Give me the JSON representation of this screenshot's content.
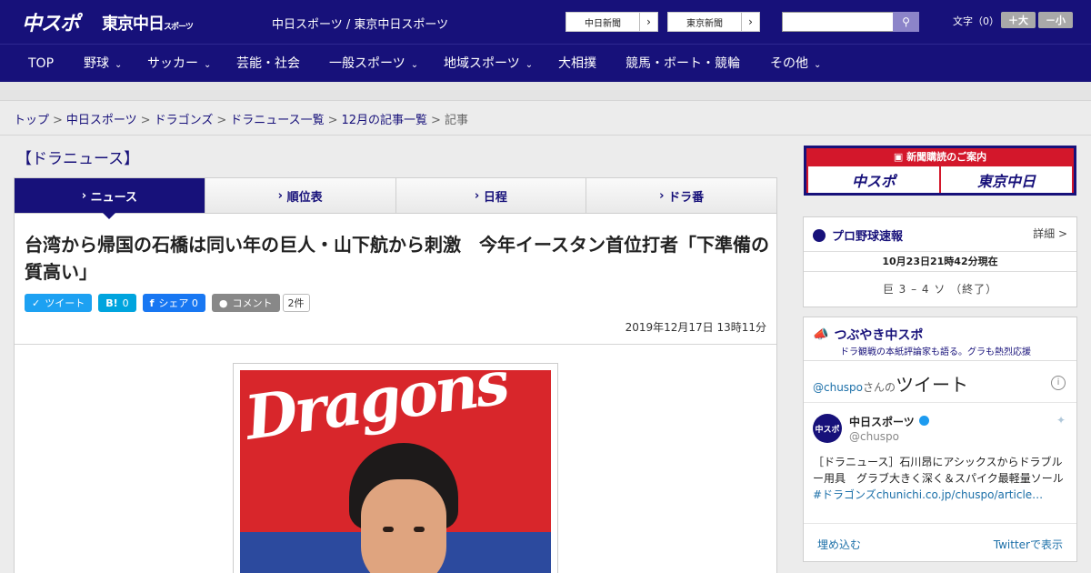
{
  "header": {
    "logo_main": "中スポ",
    "logo_tokyo": "東京中日",
    "logo_tokyo_small": "スポーツ",
    "site_links": "中日スポーツ / 東京中日スポーツ",
    "paper_buttons": [
      "中日新聞",
      "東京新聞"
    ],
    "search_placeholder": "",
    "font_size_label": "文字（0）",
    "font_bigger": "＋大",
    "font_smaller": "－小"
  },
  "nav": {
    "items": [
      {
        "label": "TOP",
        "dropdown": false
      },
      {
        "label": "野球",
        "dropdown": true
      },
      {
        "label": "サッカー",
        "dropdown": true
      },
      {
        "label": "芸能・社会",
        "dropdown": false
      },
      {
        "label": "一般スポーツ",
        "dropdown": true
      },
      {
        "label": "地域スポーツ",
        "dropdown": true
      },
      {
        "label": "大相撲",
        "dropdown": false
      },
      {
        "label": "競馬・ボート・競輪",
        "dropdown": false
      },
      {
        "label": "その他",
        "dropdown": true
      }
    ]
  },
  "breadcrumb": {
    "links": [
      "トップ",
      "中日スポーツ",
      "ドラゴンズ",
      "ドラニュース一覧",
      "12月の記事一覧"
    ],
    "current": "記事",
    "separator": ">"
  },
  "section_title": "【ドラニュース】",
  "tabs": [
    {
      "label": "ニュース",
      "active": true
    },
    {
      "label": "順位表",
      "active": false
    },
    {
      "label": "日程",
      "active": false
    },
    {
      "label": "ドラ番",
      "active": false
    }
  ],
  "article": {
    "headline": "台湾から帰国の石橋は同い年の巨人・山下航から刺激　今年イースタン首位打者「下準備の質高い」",
    "share": {
      "tweet": "ツイート",
      "hatena_count": "0",
      "facebook": "シェア",
      "facebook_count": "0",
      "comment": "コメント",
      "comment_count": "2件"
    },
    "date": "2019年12月17日 13時11分",
    "photo_text": "Dragons"
  },
  "sidebar": {
    "promo": {
      "title": "新聞購読のご案内",
      "left": "中スポ",
      "right": "東京中日"
    },
    "scores": {
      "title": "プロ野球速報",
      "detail": "詳細 >",
      "updated": "10月23日21時42分現在",
      "result": "巨 3 – 4 ソ （終了）"
    },
    "tweets": {
      "title": "つぶやき中スポ",
      "subtitle": "ドラ観戦の本紙評論家も語る。グラも熱烈応援",
      "account_prefix": "@chuspo",
      "account_suffix": "さんの",
      "heading": "ツイート",
      "user_name": "中日スポーツ",
      "user_handle": "@chuspo",
      "avatar_text": "中スポ",
      "text": "［ドラニュース］石川昂にアシックスからドラブルー用具　グラブ大きく深く＆スパイク最軽量ソール",
      "text_link": "#ドラゴンズchunichi.co.jp/chuspo/article…",
      "embed": "埋め込む",
      "view_on_twitter": "Twitterで表示"
    }
  },
  "colors": {
    "brand_navy": "#17117a",
    "promo_red": "#d3172b",
    "link_blue": "#1b6fa8"
  }
}
